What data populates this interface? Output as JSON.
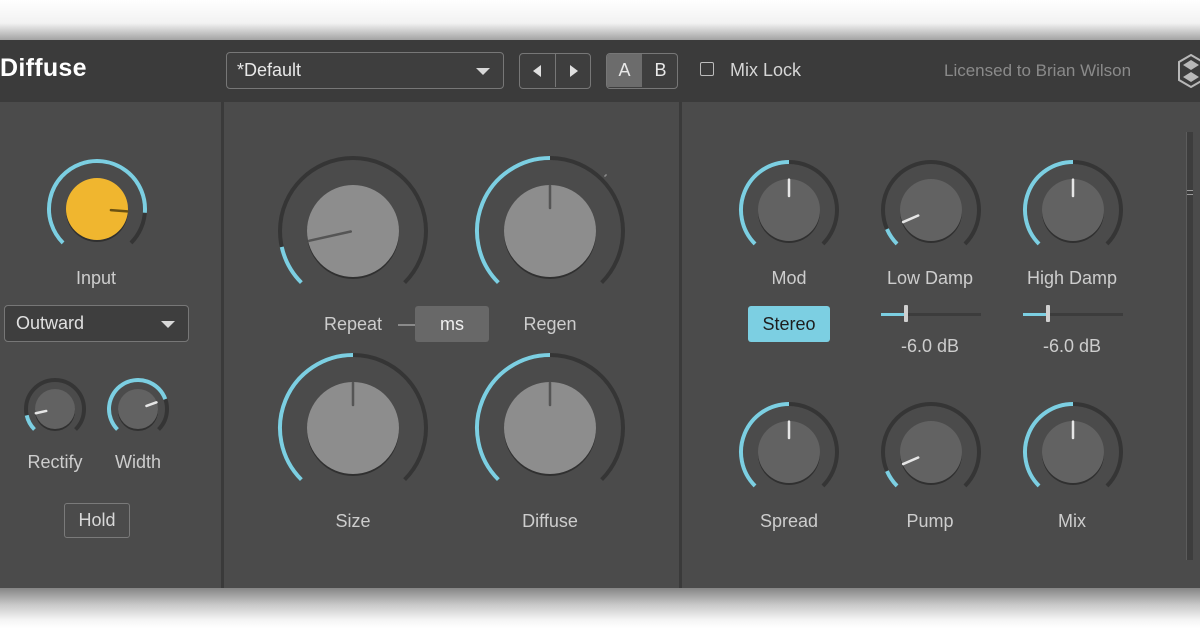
{
  "plugin": {
    "title": "Diffuse",
    "license": "Licensed to  Brian Wilson"
  },
  "header": {
    "preset": "*Default",
    "ab": {
      "a": "A",
      "b": "B",
      "selected": "A"
    },
    "mix_lock": {
      "label": "Mix Lock",
      "checked": false
    }
  },
  "input_section": {
    "input": {
      "label": "Input",
      "value": 0.85
    },
    "mode": "Outward",
    "rectify": {
      "label": "Rectify",
      "value": 0.12
    },
    "width": {
      "label": "Width",
      "value": 0.76
    },
    "hold": "Hold"
  },
  "delay_section": {
    "repeat": {
      "label": "Repeat",
      "value": 0.12
    },
    "regen": {
      "label": "Regen",
      "value": 0.5
    },
    "unit": "ms",
    "size": {
      "label": "Size",
      "value": 0.5
    },
    "diffuse": {
      "label": "Diffuse",
      "value": 0.5
    }
  },
  "output_section": {
    "mod": {
      "label": "Mod",
      "value": 0.5
    },
    "low_damp": {
      "label": "Low Damp",
      "value": 0.08,
      "gain": 0.25,
      "gain_text": "-6.0 dB"
    },
    "high_damp": {
      "label": "High Damp",
      "value": 0.5,
      "gain": 0.25,
      "gain_text": "-6.0 dB"
    },
    "stereo": "Stereo",
    "spread": {
      "label": "Spread",
      "value": 0.5
    },
    "pump": {
      "label": "Pump",
      "value": 0.08
    },
    "mix": {
      "label": "Mix",
      "value": 0.5
    }
  },
  "colors": {
    "accent": "#7ccfe2",
    "input_knob": "#f0b62f",
    "panel": "#4b4b4b",
    "header": "#3b3b3b"
  }
}
